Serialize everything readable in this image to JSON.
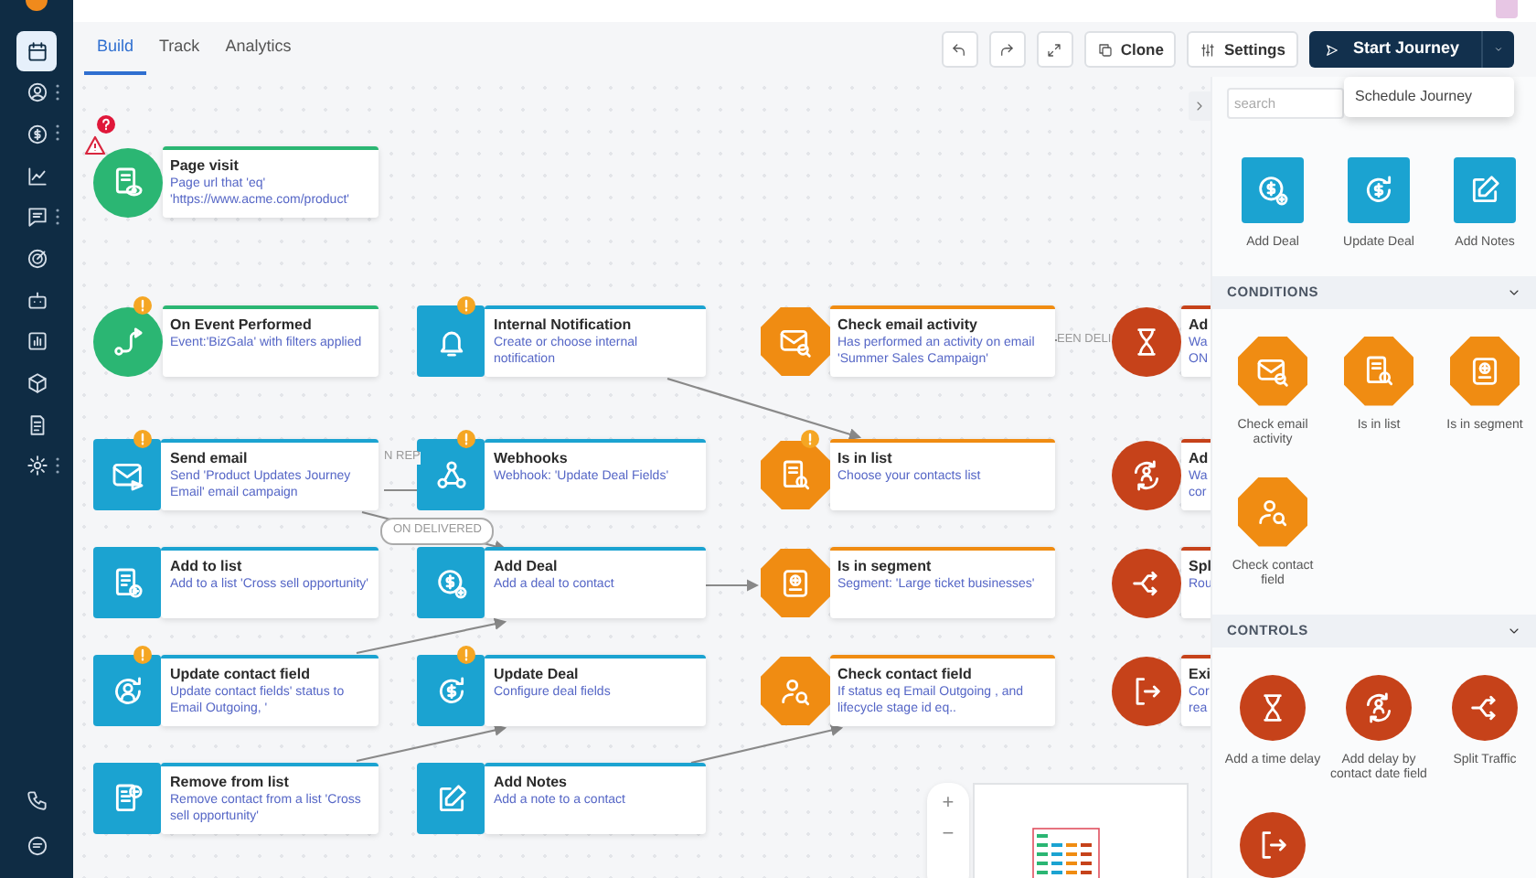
{
  "sidebar": {
    "items": [
      {
        "selected": true,
        "has_menu": false
      },
      {
        "selected": false,
        "has_menu": true
      },
      {
        "selected": false,
        "has_menu": true
      },
      {
        "selected": false,
        "has_menu": false
      },
      {
        "selected": false,
        "has_menu": true
      },
      {
        "selected": false,
        "has_menu": false
      },
      {
        "selected": false,
        "has_menu": false
      },
      {
        "selected": false,
        "has_menu": false
      },
      {
        "selected": false,
        "has_menu": false
      },
      {
        "selected": false,
        "has_menu": false
      },
      {
        "selected": false,
        "has_menu": true
      }
    ],
    "bottom_items": [
      {
        "selected": false
      },
      {
        "selected": false
      }
    ]
  },
  "tabs": [
    {
      "label": "Build",
      "selected": true
    },
    {
      "label": "Track",
      "selected": false
    },
    {
      "label": "Analytics",
      "selected": false
    }
  ],
  "toolbar": {
    "clone": "Clone",
    "settings": "Settings",
    "primary": "Start Journey",
    "menu": {
      "open": true,
      "items": [
        "Schedule Journey"
      ]
    }
  },
  "canvas": {
    "columns": [
      [
        {
          "kind": "trigger",
          "title": "Page visit",
          "description": "Page url that 'eq' 'https://www.acme.com/product'",
          "warning": false,
          "error": true
        },
        {
          "kind": "trigger",
          "title": "On Event Performed",
          "description": "Event:'BizGala' with filters applied",
          "warning": true,
          "error": false
        },
        {
          "kind": "action",
          "title": "Send email",
          "description": "Send 'Product Updates Journey Email' email campaign",
          "warning": true,
          "error": false
        },
        {
          "kind": "action",
          "title": "Add to list",
          "description": "Add to a list 'Cross sell opportunity'",
          "warning": false,
          "error": false
        },
        {
          "kind": "action",
          "title": "Update contact field",
          "description": "Update contact fields' status to Email Outgoing, '",
          "warning": true,
          "error": false
        },
        {
          "kind": "action",
          "title": "Remove from list",
          "description": "Remove contact from a list 'Cross sell opportunity'",
          "warning": false,
          "error": false
        }
      ],
      [
        {
          "kind": "action",
          "title": "Internal Notification",
          "description": "Create or choose internal notification",
          "warning": true,
          "error": false
        },
        {
          "kind": "action",
          "title": "Webhooks",
          "description": "Webhook: 'Update Deal Fields'",
          "warning": true,
          "error": false
        },
        {
          "kind": "action",
          "title": "Add Deal",
          "description": "Add a deal to contact",
          "warning": false,
          "error": false
        },
        {
          "kind": "action",
          "title": "Update Deal",
          "description": "Configure deal fields",
          "warning": true,
          "error": false
        },
        {
          "kind": "action",
          "title": "Add Notes",
          "description": "Add a note to a contact",
          "warning": false,
          "error": false
        }
      ],
      [
        {
          "kind": "condition",
          "title": "Check email activity",
          "description": "Has performed an activity on email 'Summer Sales Campaign'",
          "warning": false,
          "error": false
        },
        {
          "kind": "condition",
          "title": "Is in list",
          "description": "Choose your contacts list",
          "warning": true,
          "error": false
        },
        {
          "kind": "condition",
          "title": "Is in segment",
          "description": "Segment: 'Large ticket businesses'",
          "warning": false,
          "error": false
        },
        {
          "kind": "condition",
          "title": "Check contact field",
          "description": "If status eq Email Outgoing , and lifecycle stage id eq..",
          "warning": false,
          "error": false
        }
      ],
      [
        {
          "kind": "control",
          "title": "Ad",
          "description": "Wa\nON",
          "warning": false,
          "error": false
        },
        {
          "kind": "control",
          "title": "Ad",
          "description": "Wa\ncor",
          "warning": false,
          "error": false
        },
        {
          "kind": "control",
          "title": "Spl",
          "description": "Rou",
          "warning": false,
          "error": false
        },
        {
          "kind": "control",
          "title": "Exi",
          "description": "Cor\nrea",
          "warning": false,
          "error": false
        }
      ]
    ],
    "edge_labels": [
      "N REP",
      "ON DELIVERED",
      "EEN DELI"
    ],
    "zoom_controls": [
      "+",
      "−"
    ]
  },
  "panel": {
    "search": {
      "placeholder": "search"
    },
    "actions": [
      {
        "kind": "action",
        "label": "Add Deal"
      },
      {
        "kind": "action",
        "label": "Update Deal"
      },
      {
        "kind": "action",
        "label": "Add Notes"
      }
    ],
    "sections": [
      {
        "title": "CONDITIONS",
        "expanded": true,
        "items": [
          {
            "kind": "condition",
            "label": "Check email activity"
          },
          {
            "kind": "condition",
            "label": "Is in list"
          },
          {
            "kind": "condition",
            "label": "Is in segment"
          },
          {
            "kind": "condition",
            "label": "Check contact field"
          }
        ]
      },
      {
        "title": "CONTROLS",
        "expanded": true,
        "items": [
          {
            "kind": "control",
            "label": "Add a time delay"
          },
          {
            "kind": "control",
            "label": "Add delay by contact date field"
          },
          {
            "kind": "control",
            "label": "Split Traffic"
          },
          {
            "kind": "control"
          }
        ]
      }
    ]
  }
}
